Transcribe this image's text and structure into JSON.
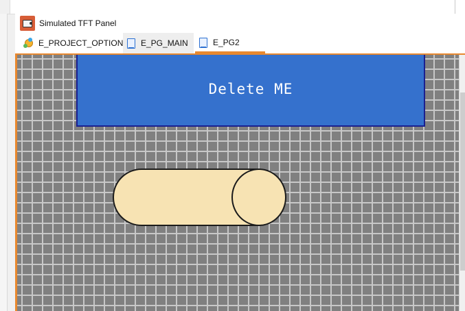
{
  "panel": {
    "title": "Simulated TFT Panel"
  },
  "tabs": [
    {
      "label": "E_PROJECT_OPTIONS",
      "icon": "project-options-icon"
    },
    {
      "label": "E_PG_MAIN",
      "icon": "page-icon"
    },
    {
      "label": "E_PG2",
      "icon": "page-icon",
      "active": true
    }
  ],
  "canvas": {
    "delete_button_label": "Delete ME",
    "toggle_state": "on"
  },
  "colors": {
    "accent": "#e8882e",
    "canvas_bg": "#808080",
    "grid": "#c8c8c8",
    "button_fill": "#3571cd",
    "button_border": "#1a1f8f",
    "toggle_fill": "#f7e3b3"
  }
}
